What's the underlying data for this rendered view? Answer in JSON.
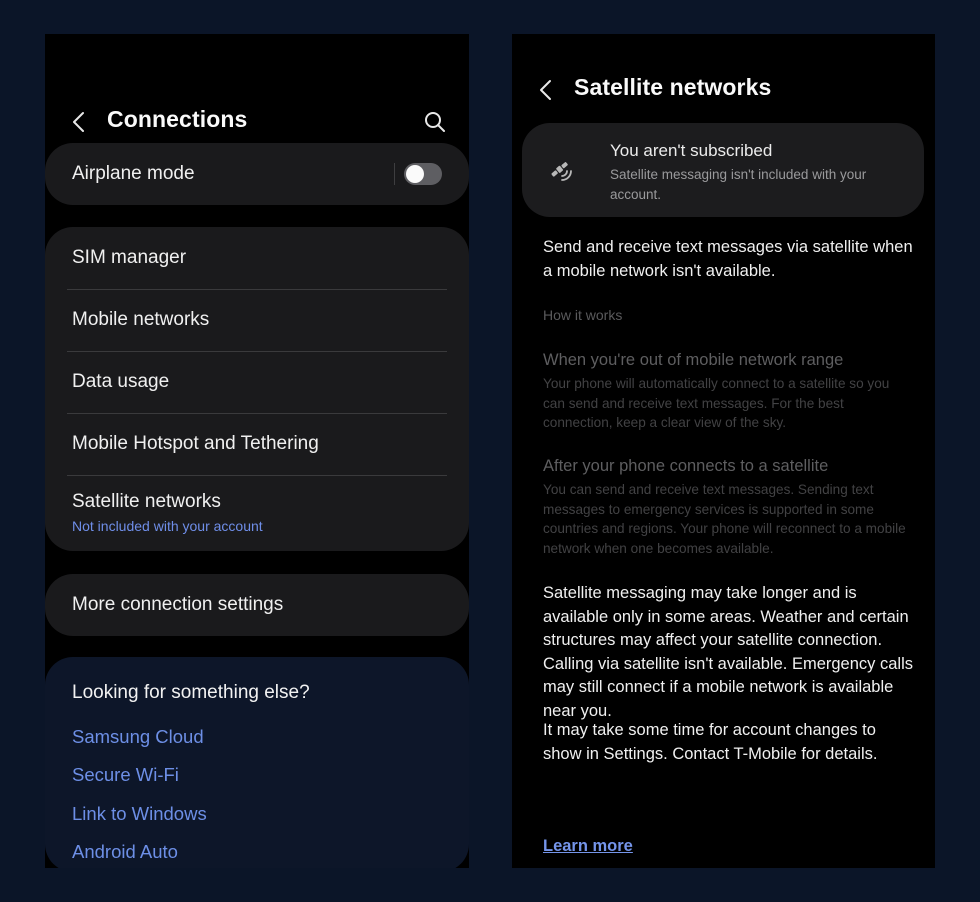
{
  "left_screen": {
    "header": {
      "title": "Connections",
      "back_icon": "chevron-left-icon",
      "search_icon": "search-icon"
    },
    "airplane": {
      "label": "Airplane mode",
      "toggle_state": "off"
    },
    "group": [
      {
        "label": "SIM manager"
      },
      {
        "label": "Mobile networks"
      },
      {
        "label": "Data usage"
      },
      {
        "label": "Mobile Hotspot and Tethering"
      },
      {
        "label": "Satellite networks",
        "sublabel": "Not included with your account"
      }
    ],
    "more": {
      "label": "More connection settings"
    },
    "suggestions": {
      "title": "Looking for something else?",
      "links": [
        "Samsung Cloud",
        "Secure Wi-Fi",
        "Link to Windows",
        "Android Auto"
      ]
    }
  },
  "right_screen": {
    "header": {
      "title": "Satellite networks",
      "back_icon": "chevron-left-icon"
    },
    "notice": {
      "icon": "satellite-icon",
      "title": "You aren't subscribed",
      "body": "Satellite messaging isn't included with your account."
    },
    "intro": "Send and receive text messages via satellite when a mobile network isn't available.",
    "how_it_works": "How it works",
    "steps": [
      {
        "title": "When you're out of mobile network range",
        "body": "Your phone will automatically connect to a satellite so you can send and receive text messages. For the best connection, keep a clear view of the sky."
      },
      {
        "title": "After your phone connects to a satellite",
        "body": "You can send and receive text messages. Sending text messages to emergency services is supported in some countries and regions. Your phone will reconnect to a mobile network when one becomes available."
      }
    ],
    "disclaimer": "Satellite messaging may take longer and is available only in some areas. Weather and certain structures may affect your satellite connection. Calling via satellite isn't available. Emergency calls may still connect if a mobile network is available near you.",
    "account_note": "It may take some time for account changes to show in Settings. Contact T-Mobile for details.",
    "learn_more": "Learn more"
  },
  "colors": {
    "link": "#6d8fe6",
    "background": "#0b1528",
    "card": "#1a1a1c"
  }
}
